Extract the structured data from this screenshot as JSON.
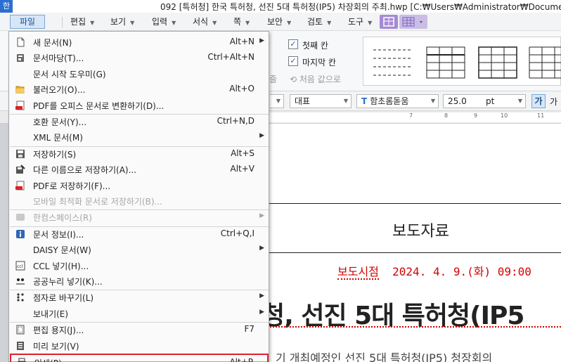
{
  "window": {
    "app_icon": "한",
    "title": "092 [특허청] 한국 특허청, 선진 5대 특허청(IP5) 차장회의 주최.hwp [C:₩Users₩Administrator₩Documents"
  },
  "menubar": {
    "file": "파일",
    "items": [
      "편집",
      "보기",
      "입력",
      "서식",
      "쪽",
      "보안",
      "검토",
      "도구"
    ]
  },
  "ribbon": {
    "first_col": "첫째 칸",
    "last_col": "마지막 칸",
    "cut_label": "줄",
    "reset_value": "처음 값으로"
  },
  "format_bar": {
    "style": "대표",
    "font_icon": "T",
    "font": "함초롬돋움",
    "size": "25.0",
    "unit": "pt",
    "bold_ga": "가",
    "ga2": "가"
  },
  "ruler": {
    "ticks": [
      "7",
      "8",
      "9",
      "10",
      "11"
    ]
  },
  "document": {
    "title": "보도자료",
    "date_label": "보도시점",
    "date_value": "2024. 4. 9.(화) 09:00",
    "headline": "청, 선진 5대 특허청(IP5",
    "body_cut": "기 개최예정인 선진 5대 특허청(IP5) 청장회의"
  },
  "file_menu": {
    "groups": [
      [
        {
          "label": "새 문서(N)",
          "shortcut": "Alt+N",
          "submenu": true,
          "icon": "new-document-icon",
          "disabled": false
        },
        {
          "label": "문서마당(T)...",
          "shortcut": "Ctrl+Alt+N",
          "submenu": false,
          "icon": "template-icon",
          "disabled": false
        },
        {
          "label": "문서 시작 도우미(G)",
          "shortcut": "",
          "submenu": false,
          "icon": "",
          "disabled": false
        },
        {
          "label": "불러오기(O)...",
          "shortcut": "Alt+O",
          "submenu": false,
          "icon": "open-folder-icon",
          "disabled": false
        },
        {
          "label": "PDF를 오피스 문서로 변환하기(D)...",
          "shortcut": "",
          "submenu": false,
          "icon": "pdf-convert-icon",
          "disabled": false
        }
      ],
      [
        {
          "label": "호환 문서(Y)...",
          "shortcut": "Ctrl+N,D",
          "submenu": false,
          "icon": "",
          "disabled": false
        },
        {
          "label": "XML 문서(M)",
          "shortcut": "",
          "submenu": true,
          "icon": "",
          "disabled": false
        }
      ],
      [
        {
          "label": "저장하기(S)",
          "shortcut": "Alt+S",
          "submenu": false,
          "icon": "save-icon",
          "disabled": false
        },
        {
          "label": "다른 이름으로 저장하기(A)...",
          "shortcut": "Alt+V",
          "submenu": false,
          "icon": "save-as-icon",
          "disabled": false
        },
        {
          "label": "PDF로 저장하기(F)...",
          "shortcut": "",
          "submenu": false,
          "icon": "pdf-save-icon",
          "disabled": false
        },
        {
          "label": "모바일 최적화 문서로 저장하기(B)...",
          "shortcut": "",
          "submenu": false,
          "icon": "",
          "disabled": true
        }
      ],
      [
        {
          "label": "한컴스페이스(R)",
          "shortcut": "",
          "submenu": true,
          "icon": "hancom-space-icon",
          "disabled": true
        }
      ],
      [
        {
          "label": "문서 정보(I)...",
          "shortcut": "Ctrl+Q,I",
          "submenu": false,
          "icon": "info-icon",
          "disabled": false
        },
        {
          "label": "DAISY 문서(W)",
          "shortcut": "",
          "submenu": true,
          "icon": "",
          "disabled": false
        },
        {
          "label": "CCL 넣기(H)...",
          "shortcut": "",
          "submenu": false,
          "icon": "ccl-icon",
          "disabled": false
        },
        {
          "label": "공공누리 넣기(K)...",
          "shortcut": "",
          "submenu": false,
          "icon": "open-license-icon",
          "disabled": false
        }
      ],
      [
        {
          "label": "점자로 바꾸기(L)",
          "shortcut": "",
          "submenu": true,
          "icon": "braille-icon",
          "disabled": false
        },
        {
          "label": "보내기(E)",
          "shortcut": "",
          "submenu": true,
          "icon": "",
          "disabled": false
        }
      ],
      [
        {
          "label": "편집 용지(J)...",
          "shortcut": "F7",
          "submenu": false,
          "icon": "page-setup-icon",
          "disabled": false
        },
        {
          "label": "미리 보기(V)",
          "shortcut": "",
          "submenu": false,
          "icon": "preview-icon",
          "disabled": false
        },
        {
          "label": "인쇄(P)...",
          "shortcut": "Alt+P",
          "submenu": false,
          "icon": "print-icon",
          "disabled": false,
          "highlighted": true
        }
      ]
    ]
  }
}
